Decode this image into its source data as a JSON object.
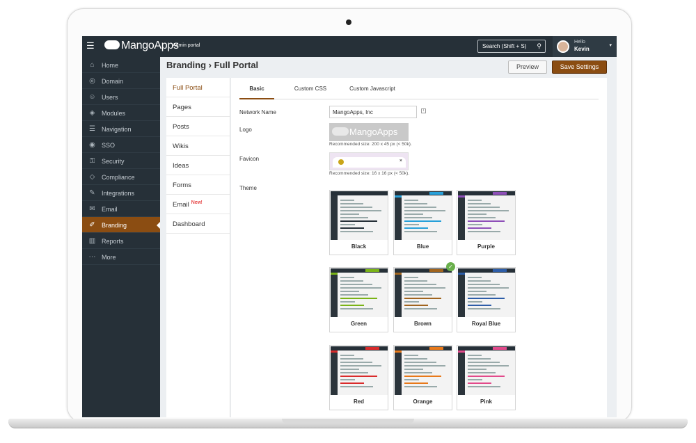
{
  "topbar": {
    "logo_text": "MangoApps",
    "portal_label": "Admin portal",
    "search_label": "Search (Shift + S)",
    "hello": "Hello",
    "user_name": "Kevin"
  },
  "sidebar": {
    "items": [
      {
        "label": "Home",
        "icon": "home-icon",
        "glyph": "⌂"
      },
      {
        "label": "Domain",
        "icon": "globe-icon",
        "glyph": "◎"
      },
      {
        "label": "Users",
        "icon": "user-icon",
        "glyph": "☺"
      },
      {
        "label": "Modules",
        "icon": "modules-icon",
        "glyph": "◈"
      },
      {
        "label": "Navigation",
        "icon": "list-icon",
        "glyph": "☰"
      },
      {
        "label": "SSO",
        "icon": "sso-icon",
        "glyph": "◉"
      },
      {
        "label": "Security",
        "icon": "key-icon",
        "glyph": "⚿"
      },
      {
        "label": "Compliance",
        "icon": "shield-icon",
        "glyph": "◇"
      },
      {
        "label": "Integrations",
        "icon": "wrench-icon",
        "glyph": "✎"
      },
      {
        "label": "Email",
        "icon": "envelope-icon",
        "glyph": "✉"
      },
      {
        "label": "Branding",
        "icon": "brush-icon",
        "glyph": "✐"
      },
      {
        "label": "Reports",
        "icon": "chart-icon",
        "glyph": "▥"
      },
      {
        "label": "More",
        "icon": "more-icon",
        "glyph": "⋯"
      }
    ]
  },
  "header": {
    "title": "Branding › Full Portal",
    "preview_label": "Preview",
    "save_label": "Save Settings"
  },
  "subnav": {
    "items": [
      {
        "label": "Full Portal"
      },
      {
        "label": "Pages"
      },
      {
        "label": "Posts"
      },
      {
        "label": "Wikis"
      },
      {
        "label": "Ideas"
      },
      {
        "label": "Forms"
      },
      {
        "label": "Email",
        "badge": "New!"
      },
      {
        "label": "Dashboard"
      }
    ]
  },
  "tabs": [
    {
      "label": "Basic"
    },
    {
      "label": "Custom CSS"
    },
    {
      "label": "Custom Javascript"
    }
  ],
  "form": {
    "network_name_label": "Network Name",
    "network_name_value": "MangoApps, Inc",
    "logo_label": "Logo",
    "logo_preview_text": "MangoApps",
    "logo_hint": "Recommended size: 200 x 45 px (< 50k).",
    "favicon_label": "Favicon",
    "favicon_close": "×",
    "favicon_hint": "Recommended size: 16 x 16 px (< 50k).",
    "theme_label": "Theme"
  },
  "themes": [
    {
      "name": "Black",
      "color": "#263038",
      "selected": false
    },
    {
      "name": "Blue",
      "color": "#27a0d9",
      "selected": false
    },
    {
      "name": "Purple",
      "color": "#8e4fb8",
      "selected": false
    },
    {
      "name": "Green",
      "color": "#7ab317",
      "selected": false
    },
    {
      "name": "Brown",
      "color": "#a0641e",
      "selected": true
    },
    {
      "name": "Royal Blue",
      "color": "#2d5da8",
      "selected": false
    },
    {
      "name": "Red",
      "color": "#d92b2b",
      "selected": false
    },
    {
      "name": "Orange",
      "color": "#e8791a",
      "selected": false
    },
    {
      "name": "Pink",
      "color": "#e24a8b",
      "selected": false
    }
  ],
  "colors": {
    "accent": "#8b4d12",
    "sidebar_bg": "#263038",
    "check": "#6ab04c",
    "new_badge": "#dd0000"
  }
}
